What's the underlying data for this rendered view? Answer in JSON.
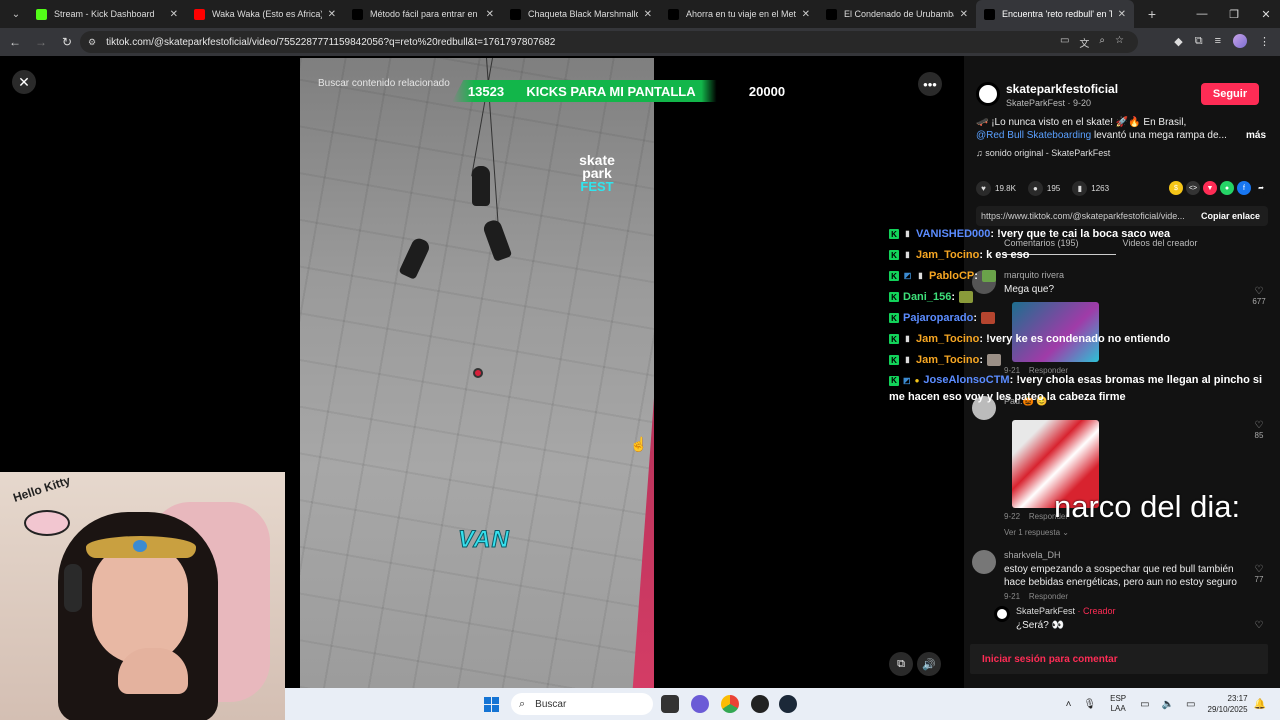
{
  "browser": {
    "tabs": [
      {
        "title": "Stream - Kick Dashboard",
        "color": "#53fc18",
        "active": false
      },
      {
        "title": "Waka Waka (Esto es Africa) (Ca",
        "color": "#ff0000",
        "active": false
      },
      {
        "title": "Método fácil para entrar en tu",
        "color": "#000000",
        "active": false
      },
      {
        "title": "Chaqueta Black Marshmallow",
        "color": "#000000",
        "active": false
      },
      {
        "title": "Ahorra en tu viaje en el Metrop",
        "color": "#000000",
        "active": false
      },
      {
        "title": "El Condenado de Urubamba: U",
        "color": "#000000",
        "active": false
      },
      {
        "title": "Encuentra 'reto redbull' en Tik",
        "color": "#000000",
        "active": true
      }
    ],
    "url": "tiktok.com/@skateparkfestoficial/video/7552287771159842056?q=reto%20redbull&t=1761797807682"
  },
  "video": {
    "search_hint": "Buscar contenido relacionado",
    "logo_top": "skate park",
    "logo_bottom": "FEST",
    "caption": "VAN"
  },
  "kick_bar": {
    "current": "13523",
    "label": "KICKS PARA MI PANTALLA",
    "goal": "20000"
  },
  "panel": {
    "author": "skateparkfestoficial",
    "author_sub": "SkateParkFest · 9-20",
    "follow_label": "Seguir",
    "desc_line1": "🛹 ¡Lo nunca visto en el skate! 🚀🔥 En Brasil,",
    "desc_mention": "@Red Bull Skateboarding",
    "desc_line2": " levantó una mega rampa de...",
    "more_label": "más",
    "sound": "♫ sonido original - SkateParkFest",
    "likes": "19.8K",
    "comments_count": "195",
    "saves": "1263",
    "link_text": "https://www.tiktok.com/@skateparkfestoficial/vide...",
    "copy_label": "Copiar enlace",
    "tab_comments": "Comentarios (195)",
    "tab_creator": "Videos del creador",
    "login_label": "Iniciar sesión para comentar",
    "comments": [
      {
        "name": "marquito rivera",
        "text": "Mega que?",
        "date": "9-21",
        "reply": "Responder",
        "likes": "677"
      },
      {
        "name": "Pau.🎃 😊",
        "text": "",
        "date": "9-22",
        "reply": "Responder",
        "likes": "85",
        "view_replies": "Ver 1 respuesta ⌄"
      },
      {
        "name": "sharkvela_DH",
        "text": "estoy empezando a sospechar que red bull también hace bebidas energéticas, pero aun no estoy seguro",
        "date": "9-21",
        "reply": "Responder",
        "likes": "77"
      },
      {
        "name": "SkateParkFest",
        "creator_tag": " · Creador",
        "text": "¿Será? 👀"
      }
    ]
  },
  "chat": [
    {
      "user": "VANISHED000",
      "color": "#5b8cff",
      "text": ": !very que te cai la boca saco wea"
    },
    {
      "user": "Jam_Tocino",
      "color": "#f6a623",
      "text": ": k es eso"
    },
    {
      "user": "PabloCP",
      "color": "#f6a623",
      "text": ":"
    },
    {
      "user": "Dani_156",
      "color": "#3ee07a",
      "text": ":"
    },
    {
      "user": "Pajaroparado",
      "color": "#5b8cff",
      "text": ":"
    },
    {
      "user": "Jam_Tocino",
      "color": "#f6a623",
      "text": ": !very ke es condenado no entiendo"
    },
    {
      "user": "Jam_Tocino",
      "color": "#f6a623",
      "text": ":"
    },
    {
      "user": "JoseAlonsoCTM",
      "color": "#5b8cff",
      "text": ": !very chola esas bromas me llegan al pincho si me hacen eso voy y les pateo la cabeza firme"
    }
  ],
  "overlay_text": "narco del dia:",
  "webcam": {
    "wall_text": "Hello Kitty"
  },
  "taskbar": {
    "search": "Buscar",
    "lang_top": "ESP",
    "lang_bottom": "LAA",
    "time": "23:17",
    "date": "29/10/2025"
  }
}
